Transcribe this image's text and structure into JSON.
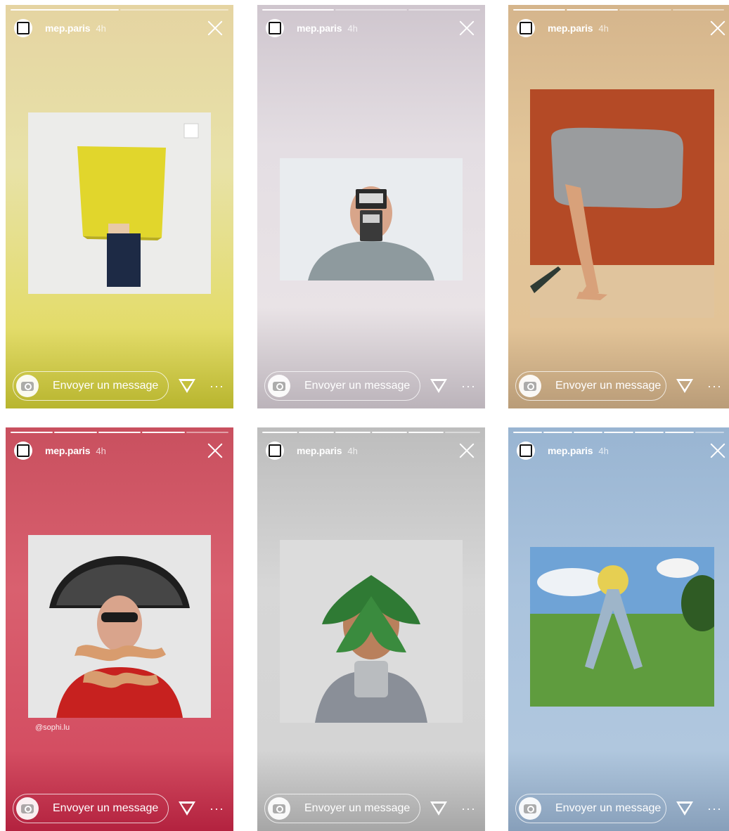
{
  "stories": [
    {
      "username": "mep.paris",
      "time": "4h",
      "credit": "",
      "message_placeholder": "Envoyer un message",
      "more": "···"
    },
    {
      "username": "mep.paris",
      "time": "4h",
      "credit": "",
      "message_placeholder": "Envoyer un message",
      "more": "···"
    },
    {
      "username": "mep.paris",
      "time": "4h",
      "credit": "",
      "message_placeholder": "Envoyer un message",
      "more": "···"
    },
    {
      "username": "mep.paris",
      "time": "4h",
      "credit": "@sophi.lu",
      "message_placeholder": "Envoyer un message",
      "more": "···"
    },
    {
      "username": "mep.paris",
      "time": "4h",
      "credit": "",
      "message_placeholder": "Envoyer un message",
      "more": "···"
    },
    {
      "username": "mep.paris",
      "time": "4h",
      "credit": "",
      "message_placeholder": "Envoyer un message",
      "more": "···"
    }
  ],
  "icons": {
    "avatar": "square-logo-icon",
    "close": "close-icon",
    "camera": "camera-icon",
    "send": "send-icon"
  }
}
